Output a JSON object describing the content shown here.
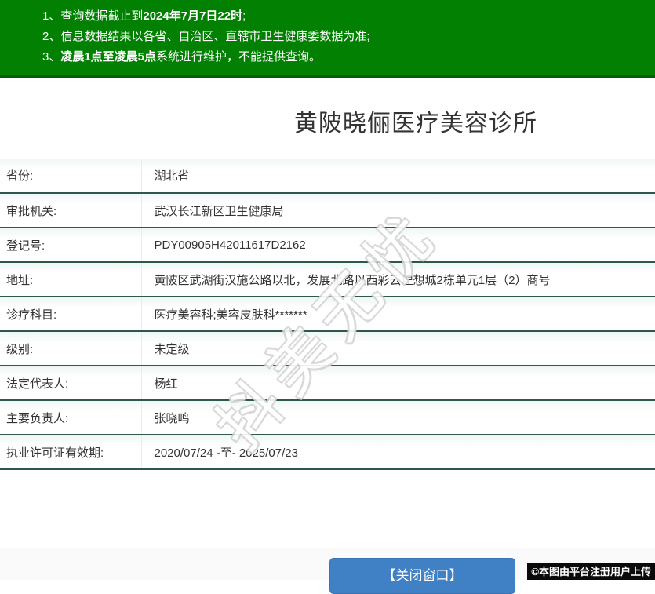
{
  "notice_bar": {
    "lines": [
      {
        "num": "1、",
        "pre": "查询数据截止到",
        "bold": "2024年7月7日22时",
        "post": ";"
      },
      {
        "num": "2、",
        "pre": "信息数据结果以各省、自治区、直辖市卫生健康委数据为准;",
        "bold": "",
        "post": ""
      },
      {
        "num": "3、",
        "pre": "",
        "bold": "凌晨1点至凌晨5点",
        "post": "系统进行维护，不能提供查询。"
      }
    ]
  },
  "page": {
    "title": "黄陂晓俪医疗美容诊所"
  },
  "info_table": {
    "rows": [
      {
        "label": "省份:",
        "value": "湖北省"
      },
      {
        "label": "审批机关:",
        "value": "武汉长江新区卫生健康局"
      },
      {
        "label": "登记号:",
        "value": "PDY00905H42011617D2162"
      },
      {
        "label": "地址:",
        "value": "黄陂区武湖街汉施公路以北，发展北路以西彩云理想城2栋单元1层（2）商号"
      },
      {
        "label": "诊疗科目:",
        "value": "医疗美容科;美容皮肤科*******"
      },
      {
        "label": "级别:",
        "value": "未定级"
      },
      {
        "label": "法定代表人:",
        "value": "杨红"
      },
      {
        "label": "主要负责人:",
        "value": "张晓鸣"
      },
      {
        "label": "执业许可证有效期:",
        "value": "2020/07/24 -至- 2025/07/23"
      }
    ]
  },
  "watermark": {
    "text": "抖美无忧"
  },
  "footer": {
    "close_button_label": "【关闭窗口】",
    "credit": "©本图由平台注册用户上传"
  },
  "colors": {
    "header_green": "#028002",
    "header_green_dark": "#015d01",
    "row_border": "#2f5651",
    "button_blue": "#4080c4"
  }
}
